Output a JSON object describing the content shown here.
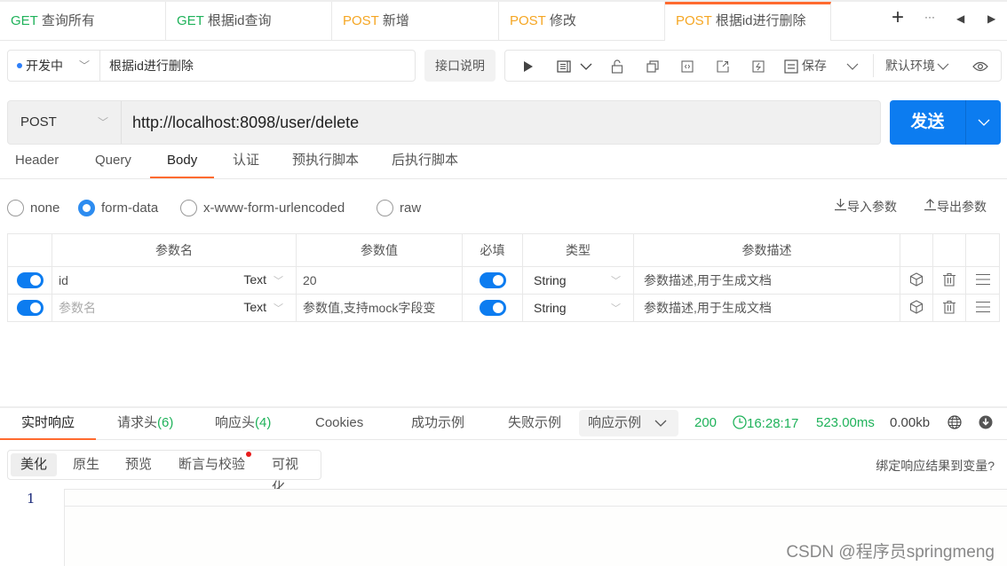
{
  "tabs": [
    {
      "method": "GET",
      "label": "查询所有",
      "active": false
    },
    {
      "method": "GET",
      "label": "根据id查询",
      "active": false
    },
    {
      "method": "POST",
      "label": "新增",
      "active": false
    },
    {
      "method": "POST",
      "label": "修改",
      "active": false
    },
    {
      "method": "POST",
      "label": "根据id进行删除",
      "active": true
    }
  ],
  "tab_controls": {
    "add": "+",
    "more": "···",
    "prev": "◀",
    "next": "▶"
  },
  "api": {
    "status": "开发中",
    "status_color": "#2d7ff9",
    "name": "根据id进行删除",
    "doc_button": "接口说明"
  },
  "toolbar": {
    "save_label": "保存",
    "environment": "默认环境"
  },
  "request": {
    "method": "POST",
    "url": "http://localhost:8098/user/delete",
    "send_label": "发送"
  },
  "request_tabs": [
    "Header",
    "Query",
    "Body",
    "认证",
    "预执行脚本",
    "后执行脚本"
  ],
  "active_request_tab": "Body",
  "body_types": [
    {
      "label": "none",
      "selected": false
    },
    {
      "label": "form-data",
      "selected": true
    },
    {
      "label": "x-www-form-urlencoded",
      "selected": false
    },
    {
      "label": "raw",
      "selected": false
    }
  ],
  "import_params": "导入参数",
  "export_params": "导出参数",
  "param_table": {
    "headers": [
      "参数名",
      "参数值",
      "必填",
      "类型",
      "参数描述"
    ],
    "rows": [
      {
        "enabled": true,
        "name": "id",
        "name_placeholder": "",
        "field_type": "Text",
        "value": "20",
        "value_placeholder": "",
        "required": true,
        "type": "String",
        "description_placeholder": "参数描述,用于生成文档"
      },
      {
        "enabled": true,
        "name": "",
        "name_placeholder": "参数名",
        "field_type": "Text",
        "value": "",
        "value_placeholder": "参数值,支持mock字段变",
        "required": true,
        "type": "String",
        "description_placeholder": "参数描述,用于生成文档"
      }
    ]
  },
  "response_tabs": {
    "realtime": "实时响应",
    "req_headers": "请求头",
    "req_headers_count": "(6)",
    "resp_headers": "响应头",
    "resp_headers_count": "(4)",
    "cookies": "Cookies",
    "success_example": "成功示例",
    "fail_example": "失败示例",
    "example_select": "响应示例"
  },
  "response_status": {
    "code": "200",
    "time": "16:28:17",
    "duration": "523.00ms",
    "size": "0.00kb"
  },
  "view_tabs": [
    "美化",
    "原生",
    "预览",
    "断言与校验",
    "可视化"
  ],
  "active_view_tab": "美化",
  "bind_label": "绑定响应结果到变量?",
  "editor": {
    "line_number": "1"
  },
  "watermark": "CSDN @程序员springmeng",
  "colors": {
    "accent": "#ff6a2f",
    "primary": "#0c7cf0",
    "get": "#1fb25a",
    "post": "#f5a623",
    "success": "#1fb25a"
  }
}
